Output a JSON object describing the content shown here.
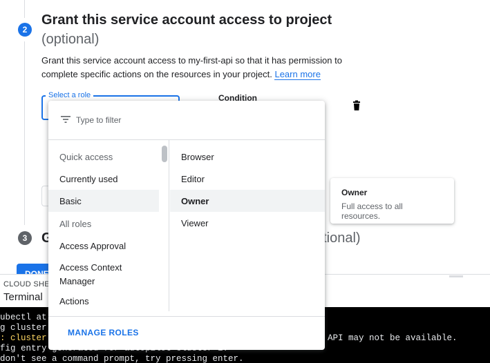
{
  "step2": {
    "number": "2",
    "title": "Grant this service account access to project",
    "subtitle": "(optional)",
    "description": "Grant this service account access to my-first-api so that it has permission to complete specific actions on the resources in your project.",
    "learn_more": "Learn more",
    "role_field_label": "Select a role",
    "condition_label": "Condition",
    "delete_icon": "trash-icon"
  },
  "step3": {
    "number": "3",
    "title": "G",
    "subtitle": "ptional)"
  },
  "done_button": "DONE",
  "tooltip": {
    "title": "Owner",
    "description": "Full access to all resources."
  },
  "role_dropdown": {
    "filter_placeholder": "Type to filter",
    "filter_icon": "filter-list-icon",
    "left_items": [
      {
        "label": "Quick access",
        "type": "header"
      },
      {
        "label": "Currently used",
        "type": "item"
      },
      {
        "label": "Basic",
        "type": "item",
        "selected": true
      },
      {
        "label": "All roles",
        "type": "header"
      },
      {
        "label": "Access Approval",
        "type": "item"
      },
      {
        "label": "Access Context Manager",
        "type": "item"
      },
      {
        "label": "Actions",
        "type": "item"
      }
    ],
    "right_items": [
      {
        "label": "Browser"
      },
      {
        "label": "Editor"
      },
      {
        "label": "Owner",
        "selected": true
      },
      {
        "label": "Viewer"
      }
    ],
    "manage_roles": "MANAGE ROLES"
  },
  "cloud_shell": {
    "label": "CLOUD SHEL",
    "tab": "Terminal",
    "lines": [
      "ubectl at",
      "g cluster",
      ": cluster",
      "fig entry generated for autopilot-cluster-1.",
      "don't see a command prompt, try pressing enter."
    ],
    "line3_tail": "API may not be available."
  },
  "colors": {
    "accent": "#1a73e8",
    "text": "#202124",
    "muted": "#5f6368",
    "terminal_bg": "#000000",
    "terminal_warn": "#fdd663"
  }
}
